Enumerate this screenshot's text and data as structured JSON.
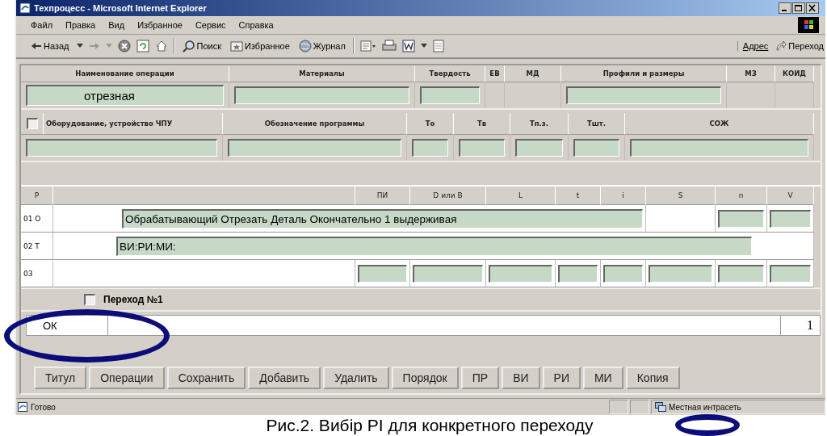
{
  "window": {
    "title": "Техпроцесс - Microsoft Internet Explorer"
  },
  "menu": [
    "Файл",
    "Правка",
    "Вид",
    "Избранное",
    "Сервис",
    "Справка"
  ],
  "toolbar": {
    "back": "Назад",
    "search": "Поиск",
    "favorites": "Избранное",
    "history": "Журнал",
    "address": "Адрес",
    "go": "Переход"
  },
  "operation": {
    "columns": [
      {
        "label": "Наименование операции",
        "field": true,
        "value": "отрезная"
      },
      {
        "label": "Материалы",
        "field": true
      },
      {
        "label": "Твердость",
        "field": true
      },
      {
        "label": "ЕВ",
        "field": false
      },
      {
        "label": "МД",
        "field": false
      },
      {
        "label": "Профили и размеры",
        "field": true
      },
      {
        "label": "МЗ",
        "field": false
      },
      {
        "label": "КОИД",
        "field": false
      }
    ]
  },
  "equipment": {
    "checked": false,
    "columns": [
      {
        "label": "Оборудование, устройство ЧПУ",
        "field": true
      },
      {
        "label": "Обозначение программы",
        "field": true
      },
      {
        "label": "То",
        "field": true
      },
      {
        "label": "Тв",
        "field": true
      },
      {
        "label": "Тп.з.",
        "field": true
      },
      {
        "label": "Тшт.",
        "field": true
      },
      {
        "label": "СОЖ",
        "field": true
      }
    ]
  },
  "steps": {
    "columns": [
      "Р",
      "ПИ",
      "D или В",
      "L",
      "t",
      "i",
      "S",
      "n",
      "V"
    ],
    "rows": [
      {
        "number": "01 О",
        "kind": "text",
        "text": "Обрабатывающий Отрезать Деталь  Окончательно  1 выдерживая"
      },
      {
        "number": "02 Т",
        "kind": "wide",
        "text": "ВИ:РИ:МИ:"
      },
      {
        "number": "03",
        "kind": "params"
      }
    ]
  },
  "transition": {
    "label": "Переход №1",
    "checked": false
  },
  "footer": {
    "status": "ОК",
    "page": "1"
  },
  "buttons": [
    "Титул",
    "Операции",
    "Сохранить",
    "Добавить",
    "Удалить",
    "Порядок",
    "ПР",
    "ВИ",
    "РИ",
    "МИ",
    "Копия"
  ],
  "status_bar": {
    "text": "Готово",
    "zone": "Местная интрасеть"
  },
  "annotations": [
    {
      "kind": "ellipse"
    },
    {
      "kind": "ellipse"
    }
  ],
  "caption": "Рис.2. Вибір РІ для конкретного переходу"
}
